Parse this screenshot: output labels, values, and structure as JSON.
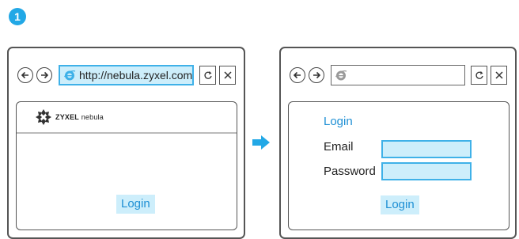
{
  "step": "1",
  "window1": {
    "url": "http://nebula.zyxel.com",
    "logo": {
      "brand": "ZYXEL",
      "product": "nebula"
    },
    "login_button": "Login"
  },
  "window2": {
    "url": "",
    "heading": "Login",
    "email_label": "Email",
    "password_label": "Password",
    "login_button": "Login"
  },
  "colors": {
    "accent": "#22a8e6",
    "field_fill": "#cdeefb",
    "link_text": "#1e8fd4",
    "border": "#555555"
  },
  "icons": [
    "back-icon",
    "forward-icon",
    "ie-icon",
    "refresh-icon",
    "close-icon",
    "step-arrow-icon",
    "zyxel-nebula-logo"
  ]
}
